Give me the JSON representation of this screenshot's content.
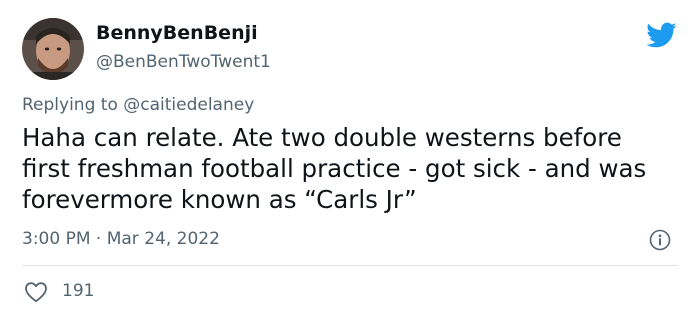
{
  "tweet": {
    "author": {
      "display_name": "BennyBenBenji",
      "handle": "@BenBenTwoTwent1"
    },
    "reply_prefix": "Replying to ",
    "reply_to": "@caitiedelaney",
    "text": "Haha can relate. Ate two double westerns before\nfirst freshman football practice - got sick - and was\nforevermore known as “Carls Jr”",
    "timestamp": "3:00 PM · Mar 24, 2022",
    "likes": "191"
  },
  "icons": {
    "brand": "twitter-bird-icon",
    "info": "info-icon",
    "like": "heart-icon"
  },
  "colors": {
    "brand": "#1d9bf0",
    "text": "#0f1419",
    "secondary": "#536471",
    "divider": "#dfe4e8"
  }
}
